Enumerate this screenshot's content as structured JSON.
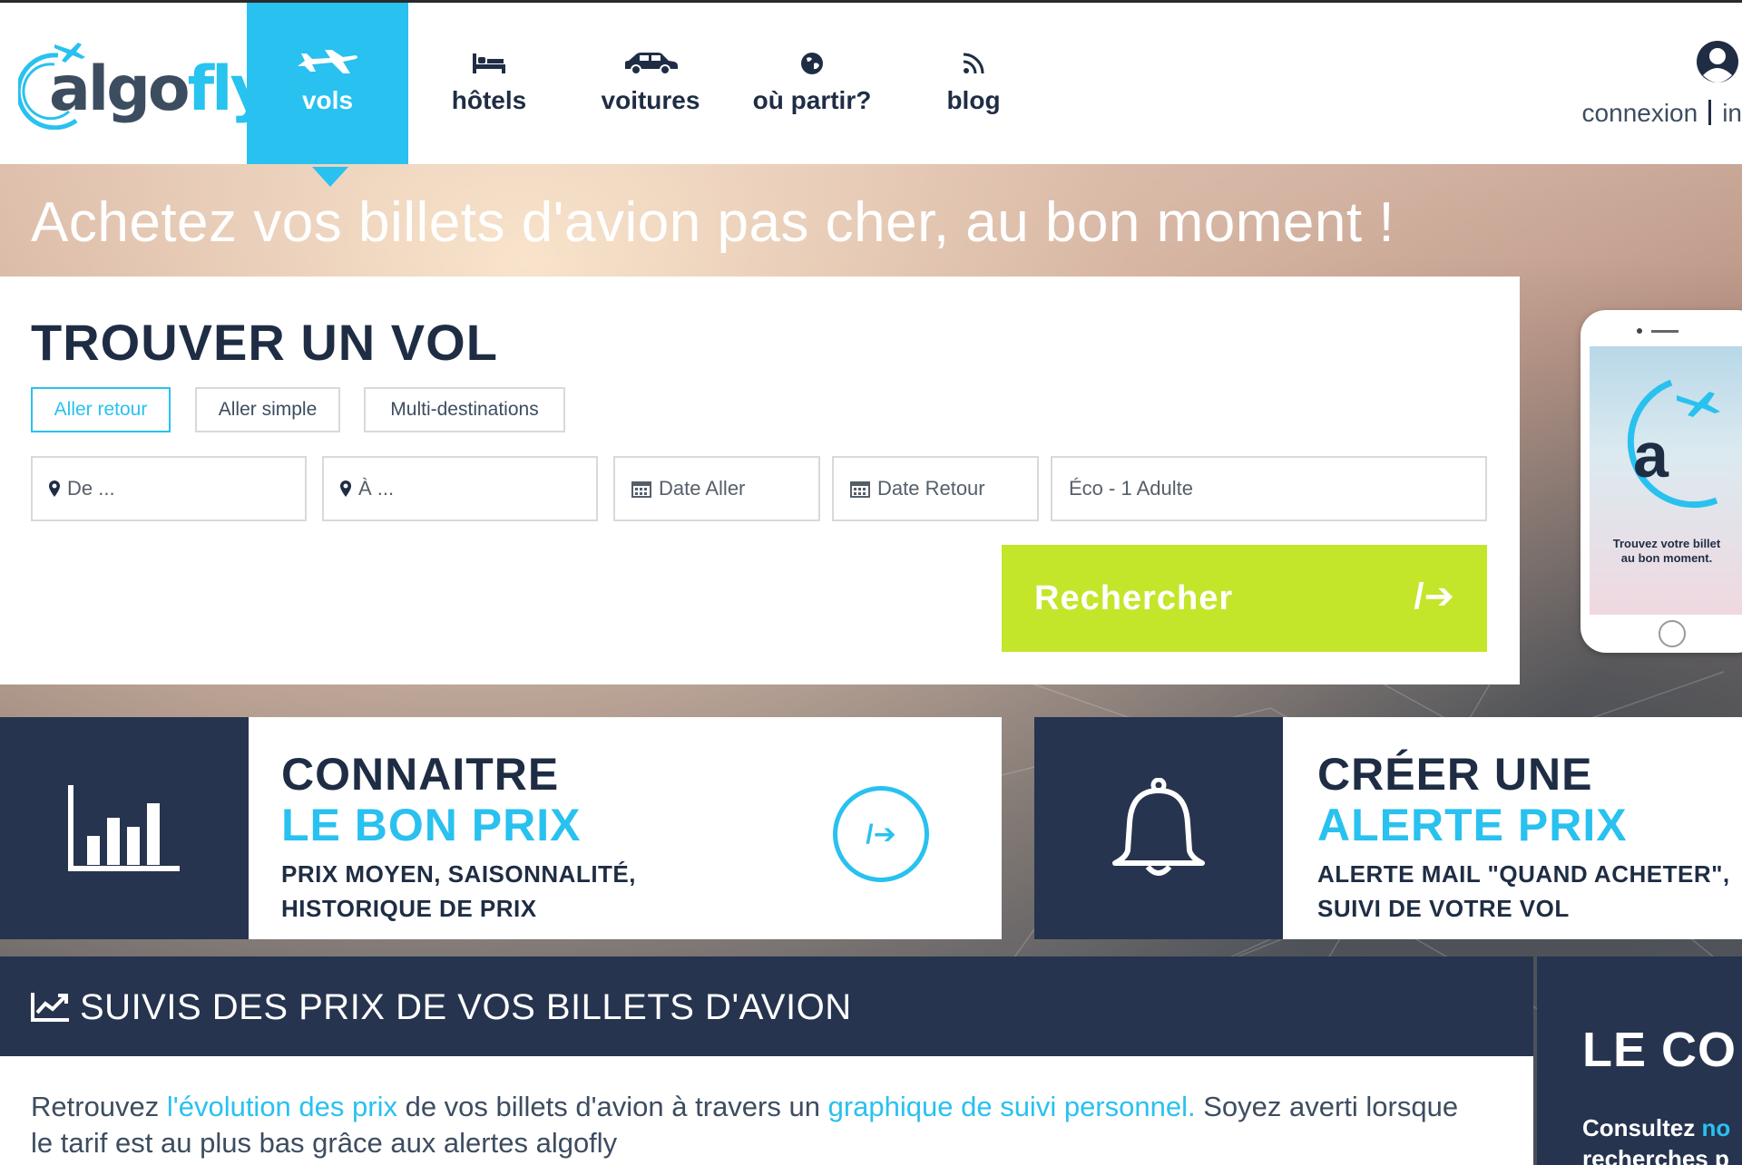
{
  "brand": {
    "logo_main": "algo",
    "logo_accent": "fly",
    "accent_color": "#29c1ef",
    "dark_color": "#26344f",
    "cta_color": "#c3e62a"
  },
  "nav": {
    "items": [
      {
        "label": "vols",
        "icon": "plane-icon"
      },
      {
        "label": "hôtels",
        "icon": "bed-icon"
      },
      {
        "label": "voitures",
        "icon": "car-icon"
      },
      {
        "label": "où partir?",
        "icon": "globe-icon"
      },
      {
        "label": "blog",
        "icon": "rss-icon"
      }
    ],
    "active": "vols"
  },
  "account": {
    "login": "connexion",
    "signup": "in"
  },
  "hero": {
    "title": "Achetez vos billets d'avion pas cher, au bon moment !"
  },
  "search": {
    "title": "TROUVER UN VOL",
    "trip_types": [
      "Aller retour",
      "Aller simple",
      "Multi-destinations"
    ],
    "selected_trip": "Aller retour",
    "from_placeholder": "De ...",
    "to_placeholder": "À ...",
    "depart_placeholder": "Date Aller",
    "return_placeholder": "Date Retour",
    "passengers": "Éco - 1 Adulte",
    "submit_label": "Rechercher",
    "submit_arrow": "/➔"
  },
  "promo_phone": {
    "tagline_1": "Trouvez votre billet",
    "tagline_2": "au bon moment.",
    "letter": "a"
  },
  "features": [
    {
      "title_1": "CONNAITRE",
      "title_2": "LE BON PRIX",
      "desc_1": "PRIX MOYEN, SAISONNALITÉ,",
      "desc_2": "HISTORIQUE DE PRIX",
      "icon": "bar-chart-icon",
      "arrow": "/➔"
    },
    {
      "title_1": "CRÉER UNE",
      "title_2": "ALERTE PRIX",
      "desc_1": "ALERTE MAIL \"QUAND ACHETER\",",
      "desc_2": "SUIVI DE VOTRE VOL",
      "icon": "bell-icon"
    }
  ],
  "tracking": {
    "title": "SUIVIS DES PRIX DE VOS BILLETS D'AVION",
    "text_1": "Retrouvez ",
    "link_1": "l'évolution des prix",
    "text_2": " de vos billets d'avion à travers un ",
    "link_2": "graphique de suivi personnel.",
    "text_3": " Soyez averti lorsque le tarif est au plus bas grâce aux alertes algofly"
  },
  "side_panel": {
    "title": "LE CO",
    "text_1": "Consultez ",
    "text_highlight": "no",
    "text_2": "recherches p"
  }
}
